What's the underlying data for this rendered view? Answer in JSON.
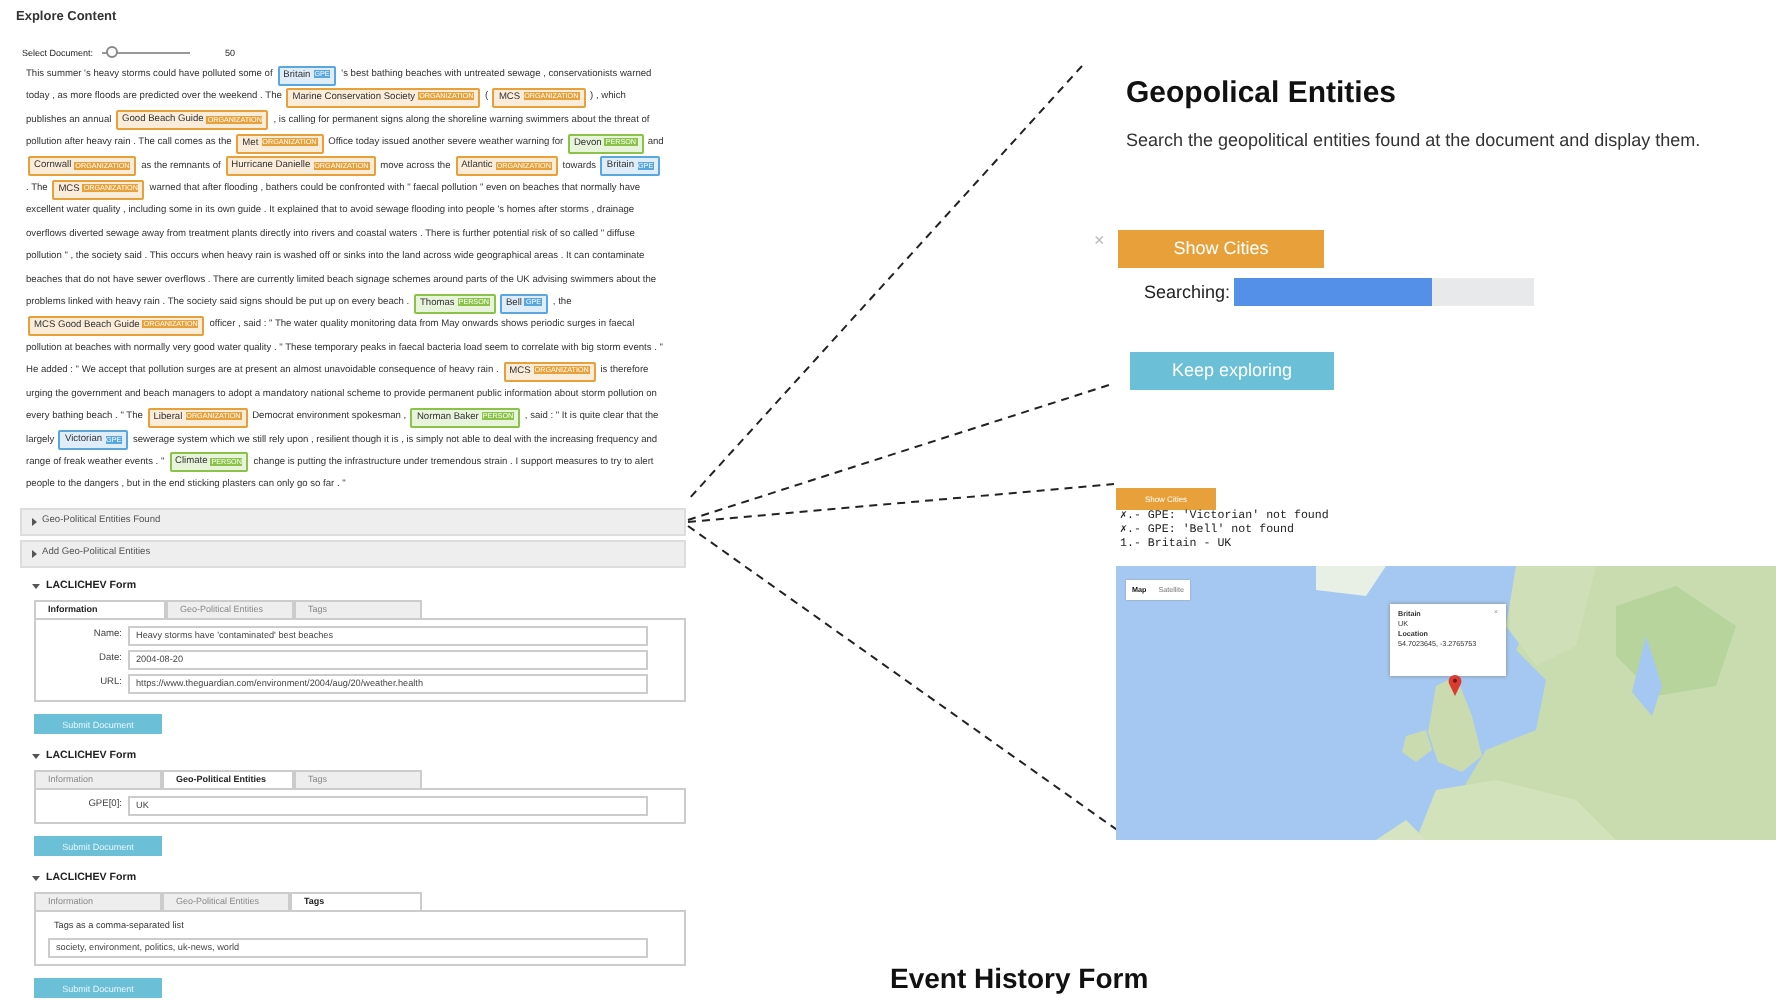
{
  "explore": {
    "title": "Explore Content",
    "slider": {
      "label": "Select Document:",
      "level": 0.06,
      "reading": "50"
    },
    "segments": [
      {
        "kind": "text",
        "text": "This summer 's heavy storms could have polluted some of "
      },
      {
        "kind": "entity",
        "text": "Britain",
        "label": "GPE",
        "color": "#5aa7e0"
      },
      {
        "kind": "text",
        "text": " 's best bathing beaches with untreated sewage , conservationists warned today , as more floods are predicted over the weekend . The "
      },
      {
        "kind": "entity",
        "text": "Marine Conservation Society",
        "label": "ORGANIZATION",
        "color": "#e8a13a"
      },
      {
        "kind": "text",
        "text": " ( "
      },
      {
        "kind": "entity",
        "text": "MCS",
        "label": "ORGANIZATION",
        "color": "#e8a13a"
      },
      {
        "kind": "text",
        "text": " ) , which publishes an annual "
      },
      {
        "kind": "entity",
        "text": "Good Beach Guide",
        "label": "ORGANIZATION",
        "color": "#e8a13a"
      },
      {
        "kind": "text",
        "text": " , is calling for permanent signs along the shoreline warning swimmers about the threat of pollution after heavy rain . The call comes as the "
      },
      {
        "kind": "entity",
        "text": "Met",
        "label": "ORGANIZATION",
        "color": "#e8a13a"
      },
      {
        "kind": "text",
        "text": " Office today issued another severe weather warning for "
      },
      {
        "kind": "entity",
        "text": "Devon",
        "label": "PERSON",
        "color": "#8bc34a"
      },
      {
        "kind": "text",
        "text": " and "
      },
      {
        "kind": "entity",
        "text": "Cornwall",
        "label": "ORGANIZATION",
        "color": "#e8a13a"
      },
      {
        "kind": "text",
        "text": " as the remnants of "
      },
      {
        "kind": "entity",
        "text": "Hurricane Danielle",
        "label": "ORGANIZATION",
        "color": "#e8a13a"
      },
      {
        "kind": "text",
        "text": " move across the "
      },
      {
        "kind": "entity",
        "text": "Atlantic",
        "label": "ORGANIZATION",
        "color": "#e8a13a"
      },
      {
        "kind": "text",
        "text": " towards "
      },
      {
        "kind": "entity",
        "text": "Britain",
        "label": "GPE",
        "color": "#5aa7e0"
      },
      {
        "kind": "text",
        "text": " . The "
      },
      {
        "kind": "entity",
        "text": "MCS",
        "label": "ORGANIZATION",
        "color": "#e8a13a"
      },
      {
        "kind": "text",
        "text": " warned that after flooding , bathers could be confronted with \" faecal pollution \" even on beaches that normally have excellent water quality , including some in its own guide . It explained that to avoid sewage flooding into people 's homes after storms , drainage overflows diverted sewage away from treatment plants directly into rivers and coastal waters . There is further potential risk of so called \" diffuse pollution \" , the society said . This occurs when heavy rain is washed off or sinks into the land across wide geographical areas . It can contaminate beaches that do not have sewer overflows . There are currently limited beach signage schemes around parts of the UK advising swimmers about the problems linked with heavy rain . The society said signs should be put up on every beach . "
      },
      {
        "kind": "entity",
        "text": "Thomas",
        "label": "PERSON",
        "color": "#8bc34a"
      },
      {
        "kind": "entity",
        "text": "Bell",
        "label": "GPE",
        "color": "#5aa7e0"
      },
      {
        "kind": "text",
        "text": " , the "
      },
      {
        "kind": "entity",
        "text": "MCS Good Beach Guide",
        "label": "ORGANIZATION",
        "color": "#e8a13a"
      },
      {
        "kind": "text",
        "text": " officer , said : \" The water quality monitoring data from May onwards shows periodic surges in faecal pollution at beaches with normally very good water quality . \" These temporary peaks in faecal bacteria load seem to correlate with big storm events . \" He added : \" We accept that pollution surges are at present an almost unavoidable consequence of heavy rain . "
      },
      {
        "kind": "entity",
        "text": "MCS",
        "label": "ORGANIZATION",
        "color": "#e8a13a"
      },
      {
        "kind": "text",
        "text": " is therefore urging the government and beach managers to adopt a mandatory national scheme to provide permanent public information about storm pollution on every bathing beach . \" The "
      },
      {
        "kind": "entity",
        "text": "Liberal",
        "label": "ORGANIZATION",
        "color": "#e8a13a"
      },
      {
        "kind": "text",
        "text": " Democrat environment spokesman , "
      },
      {
        "kind": "entity",
        "text": "Norman Baker",
        "label": "PERSON",
        "color": "#8bc34a"
      },
      {
        "kind": "text",
        "text": " , said : \" It is quite clear that the largely "
      },
      {
        "kind": "entity",
        "text": "Victorian",
        "label": "GPE",
        "color": "#5aa7e0"
      },
      {
        "kind": "text",
        "text": " sewerage system which we still rely upon , resilient though it is , is simply not able to deal with the increasing frequency and range of freak weather events . \" "
      },
      {
        "kind": "entity",
        "text": "Climate",
        "label": "PERSON",
        "color": "#8bc34a"
      },
      {
        "kind": "text",
        "text": " change is putting the infrastructure under tremendous strain . I support measures to try to alert people to the dangers , but in the end sticking plasters can only go so far . \""
      }
    ]
  },
  "accordions": [
    {
      "label": "Geo-Political Entities Found",
      "expanded": false
    },
    {
      "label": "Add Geo-Political Entities",
      "expanded": false
    }
  ],
  "forms": [
    {
      "title": "LACLICHEV Form",
      "expanded": true,
      "tabs": [
        {
          "label": "Information",
          "selected": true
        },
        {
          "label": "Geo-Political Entities",
          "selected": false
        },
        {
          "label": "Tags",
          "selected": false
        }
      ],
      "content": {
        "kind": "fields",
        "fields": [
          {
            "label": "Name:",
            "value": "Heavy storms have 'contaminated' best beaches"
          },
          {
            "label": "Date:",
            "value": "2004-08-20"
          },
          {
            "label": "URL:",
            "value": "https://www.theguardian.com/environment/2004/aug/20/weather.health"
          }
        ]
      },
      "submit": "Submit Document"
    },
    {
      "title": "LACLICHEV Form",
      "expanded": true,
      "tabs": [
        {
          "label": "Information",
          "selected": false
        },
        {
          "label": "Geo-Political Entities",
          "selected": true
        },
        {
          "label": "Tags",
          "selected": false
        }
      ],
      "content": {
        "kind": "fields",
        "fields": [
          {
            "label": "GPE[0]:",
            "value": "UK"
          }
        ]
      },
      "submit": "Submit Document"
    },
    {
      "title": "LACLICHEV Form",
      "expanded": true,
      "tabs": [
        {
          "label": "Information",
          "selected": false
        },
        {
          "label": "Geo-Political Entities",
          "selected": false
        },
        {
          "label": "Tags",
          "selected": true
        }
      ],
      "content": {
        "kind": "tags",
        "label": "Tags as a comma-separated list",
        "value": "society, environment, politics, uk-news, world"
      },
      "submit": "Submit Document"
    }
  ],
  "geo_panel": {
    "title": "Geopolical Entities",
    "description": "Search the geopolitical entities found at the document and display them.",
    "close": "×",
    "show_button": "Show Cities",
    "progress": {
      "label": "Searching:",
      "level": 0.66
    },
    "keep_button": "Keep exploring"
  },
  "result_panel": {
    "show_button": "Show Cities",
    "log": [
      "✗.- GPE: 'Victorian' not found",
      "✗.- GPE: 'Bell' not found",
      "1.- Britain - UK"
    ],
    "map": {
      "view_buttons": [
        {
          "label": "Map",
          "selected": true
        },
        {
          "label": "Satellite",
          "selected": false
        }
      ],
      "popup": {
        "title": "Britain",
        "subtitle": "UK",
        "location_label": "Location",
        "coordinates": "54.7023645, -3.2765753",
        "close": "×"
      }
    }
  },
  "event_heading": "Event History Form"
}
